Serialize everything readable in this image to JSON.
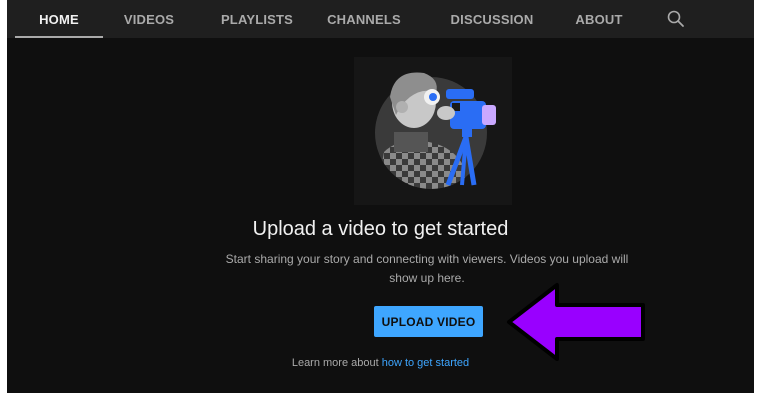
{
  "tabs": [
    {
      "label": "HOME",
      "active": true
    },
    {
      "label": "VIDEOS",
      "active": false
    },
    {
      "label": "PLAYLISTS",
      "active": false
    },
    {
      "label": "CHANNELS",
      "active": false
    },
    {
      "label": "DISCUSSION",
      "active": false
    },
    {
      "label": "ABOUT",
      "active": false
    }
  ],
  "search_icon": "search-icon",
  "empty_state": {
    "illustration": "camera-operator-illustration",
    "heading": "Upload a video to get started",
    "description": "Start sharing your story and connecting with viewers. Videos you upload will show up here.",
    "upload_button": "UPLOAD VIDEO",
    "learn_prefix": "Learn more about ",
    "learn_link": "how to get started"
  },
  "annotation": {
    "icon": "purple-arrow-icon",
    "color": "#9900ff"
  },
  "colors": {
    "accent": "#3ea6ff",
    "background": "#0f0f0f",
    "tabbar": "#1f1f1f"
  }
}
